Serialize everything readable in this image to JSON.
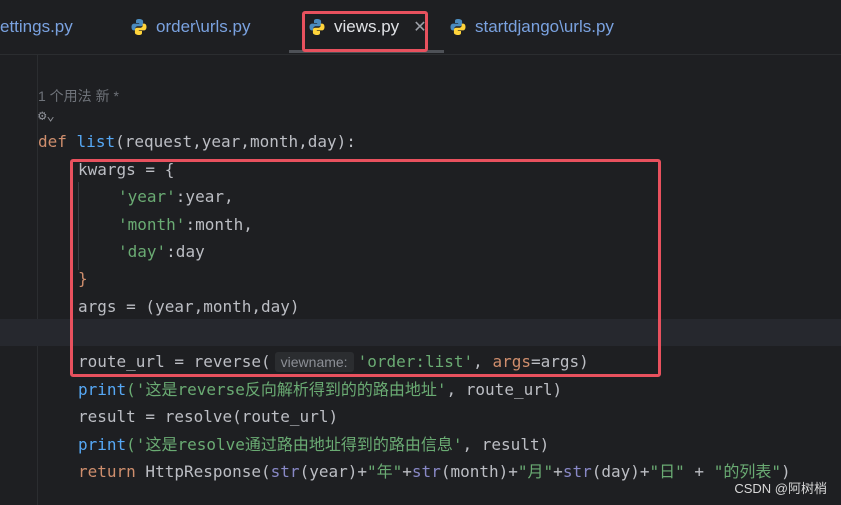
{
  "tabs": [
    {
      "label": "ettings.py",
      "active": false
    },
    {
      "label": "order\\urls.py",
      "active": false
    },
    {
      "label": "views.py",
      "active": true
    },
    {
      "label": "startdjango\\urls.py",
      "active": false
    }
  ],
  "close_glyph": "✕",
  "usage_hint": "1 个用法   新 *",
  "code": {
    "def_kw": "def",
    "fn_name": "list",
    "params": "(request,year,month,day):",
    "kwargs_line": "kwargs = {",
    "year_key": "'year'",
    "year_val": ":year,",
    "month_key": "'month'",
    "month_val": ":month,",
    "day_key": "'day'",
    "day_val": ":day",
    "close_brace": "}",
    "args_line": "args = (year,month,day)",
    "route_pre": "route_url = reverse(",
    "viewname_hint": "viewname:",
    "route_str": "'order:list'",
    "route_post": ", ",
    "args_kw": "args",
    "route_end": "=args)",
    "print1_fn": "print",
    "print1_str": "('这是reverse反向解析得到的的路由地址'",
    "print1_rest": ", route_url)",
    "resolve_line": "result = resolve(route_url)",
    "print2_fn": "print",
    "print2_str": "('这是resolve通过路由地址得到的路由信息'",
    "print2_rest": ", result)",
    "ret_kw": "return",
    "ret_rest1": " HttpResponse(",
    "ret_str_fn": "str",
    "ret_a": "(year)+",
    "ret_s1": "\"年\"",
    "ret_b": "+",
    "ret_c": "(month)+",
    "ret_s2": "\"月\"",
    "ret_d": "+",
    "ret_e": "(day)+",
    "ret_s3": "\"日\"",
    "ret_f": " + ",
    "ret_s4": "\"的列表\"",
    "ret_g": ")"
  },
  "watermark": "CSDN @阿树梢",
  "colors": {
    "highlight_box": "#e8515e",
    "keyword": "#cf8e6d",
    "string": "#6aab73",
    "function": "#56a8f5"
  }
}
